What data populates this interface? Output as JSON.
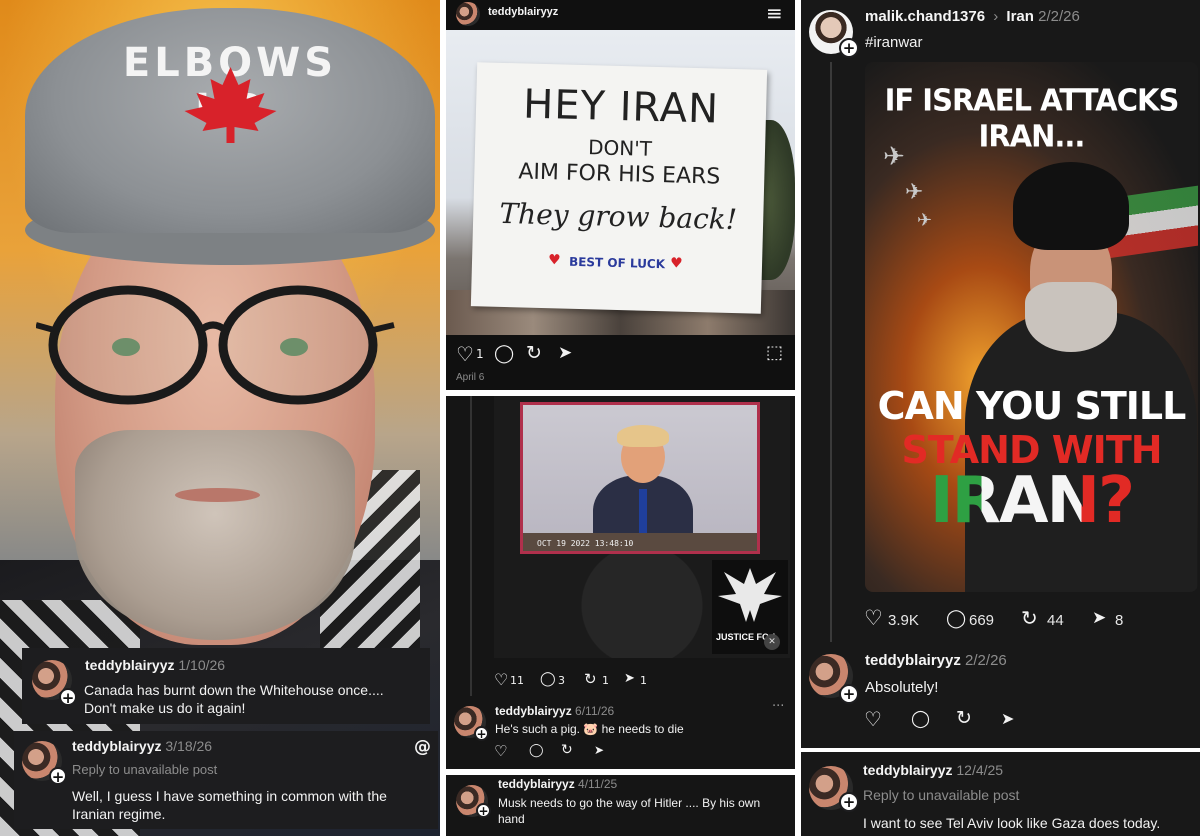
{
  "portrait": {
    "cap_text": "ELBOWS UP"
  },
  "comments_left": [
    {
      "username": "teddyblairyyz",
      "date": "1/10/26",
      "reply_note": "",
      "text_line1": "Canada has burnt down the Whitehouse once....",
      "text_line2": "Don't make us do it again!"
    },
    {
      "username": "teddyblairyyz",
      "date": "3/18/26",
      "reply_note": "Reply to unavailable post",
      "text_line1": "Well, I guess I have something in common with the",
      "text_line2": "Iranian regime."
    }
  ],
  "post_sign": {
    "username": "teddyblairyyz",
    "sign_line1": "HEY IRAN",
    "sign_line2": "DON'T",
    "sign_line3": "AIM FOR HIS EARS",
    "sign_line4": "They grow back!",
    "sign_line5": "BEST OF LUCK",
    "likes": "1",
    "date": "April 6"
  },
  "post_video": {
    "timestamp_overlay": "OCT 19 2022 13:48:10",
    "logo_text": "JUSTICE FO  L",
    "likes": "11",
    "replies": "3",
    "reposts": "1",
    "shares": "1",
    "reply_username": "teddyblairyyz",
    "reply_date": "6/11/26",
    "reply_text": "He's such a pig. 🐷 he needs to die"
  },
  "post_musk": {
    "username": "teddyblairyyz",
    "date": "4/11/25",
    "text_line1": "Musk needs to go the way of Hitler .... By his own",
    "text_line2": "hand"
  },
  "post_poster": {
    "username": "malik.chand1376",
    "breadcrumb_sep": "›",
    "topic": "Iran",
    "date": "2/2/26",
    "hashtag": "#iranwar",
    "headline_top": "IF ISRAEL ATTACKS IRAN...",
    "headline_b1": "CAN YOU STILL",
    "headline_b2": "STAND WITH",
    "headline_b3": "IRAN?",
    "likes": "3.9K",
    "replies": "669",
    "reposts": "44",
    "shares": "8",
    "reply_username": "teddyblairyyz",
    "reply_date": "2/2/26",
    "reply_text": "Absolutely!"
  },
  "post_tel_aviv": {
    "username": "teddyblairyyz",
    "date": "12/4/25",
    "reply_note": "Reply to unavailable post",
    "text": "I want to see Tel Aviv look like Gaza does today."
  },
  "icons": {
    "heart": "♡",
    "reply": "◯",
    "repost": "↻",
    "share": "➤",
    "bookmark": "⬚",
    "menu": "≡",
    "more": "···",
    "threads": "@",
    "plus": "+"
  },
  "colors": {
    "card_bg": "#1d1d1f",
    "muted": "#8c8c8c",
    "flag_red": "#e22a25",
    "flag_green": "#2ea043"
  }
}
